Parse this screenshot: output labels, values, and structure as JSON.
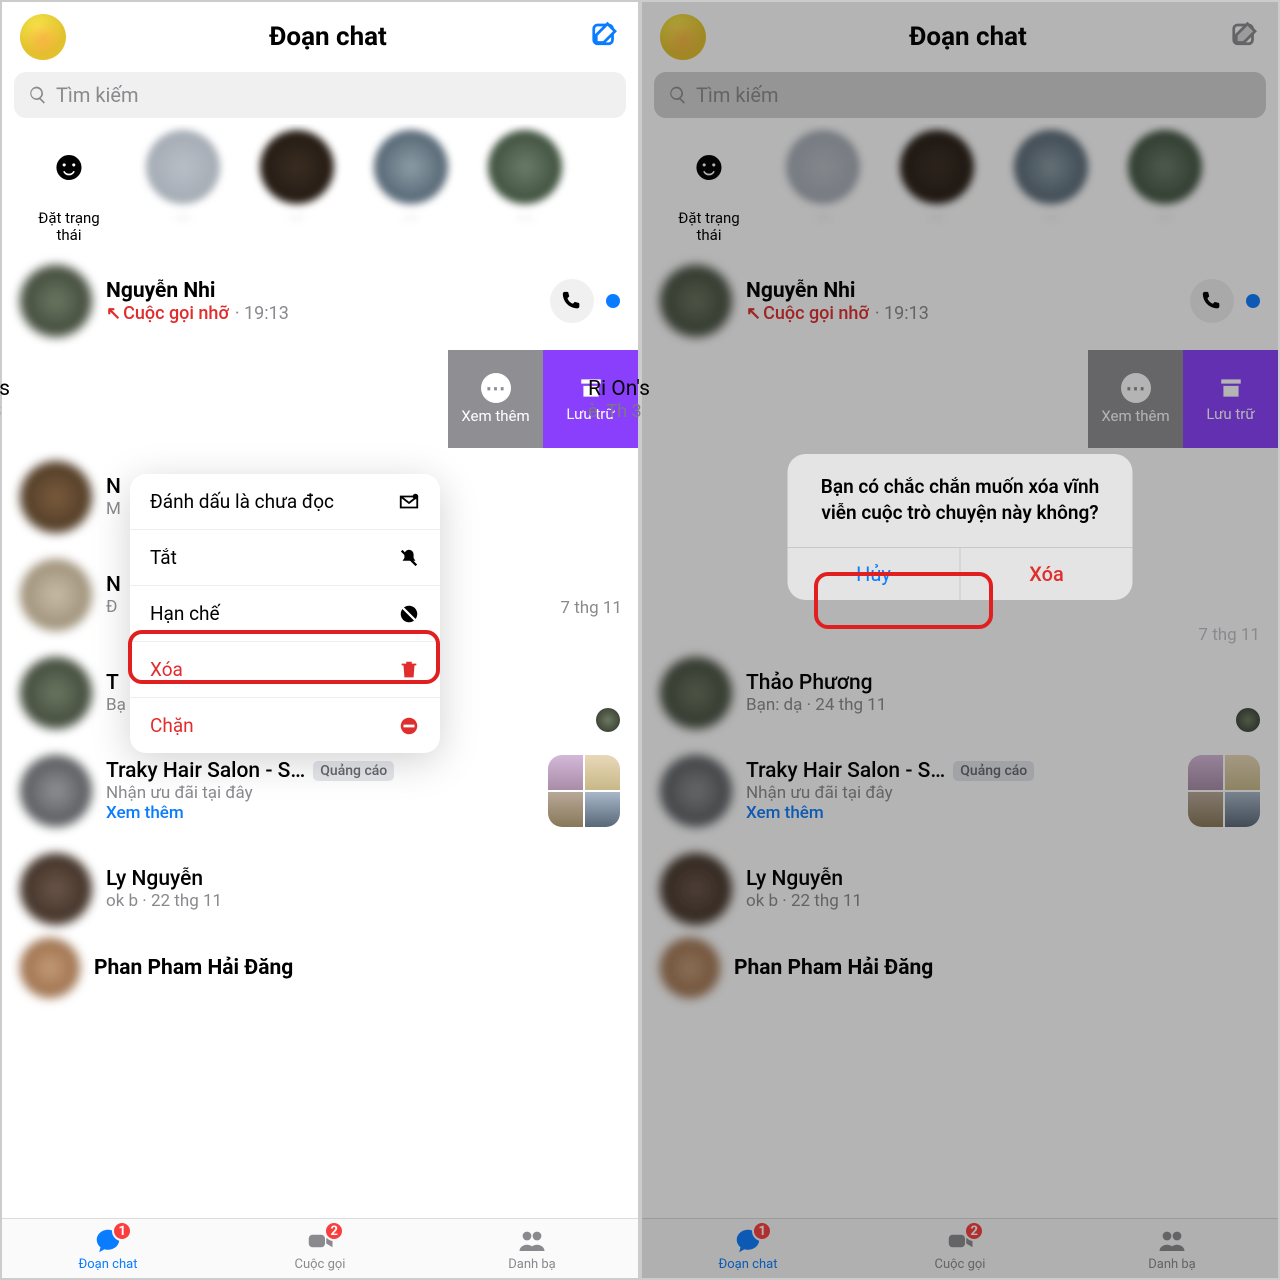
{
  "header": {
    "title": "Đoạn chat"
  },
  "search": {
    "placeholder": "Tìm kiếm"
  },
  "stories": {
    "set_status": "Đặt trạng\nthái"
  },
  "chats": {
    "c1": {
      "name": "Nguyễn Nhi",
      "missed": "Cuộc gọi nhỡ",
      "time": "19:13"
    },
    "c2": {
      "name": "Ri On's",
      "sub": "è.",
      "time": "Th 3"
    },
    "c3": {
      "name_initial": "N",
      "sub_initial": "M"
    },
    "c4": {
      "name_initial": "N",
      "sub_initial": "Đ",
      "date": "7 thg 11"
    },
    "c5": {
      "name_initial": "T",
      "sub_initial": "Bạ",
      "name_full": "Thảo Phương",
      "sub_full": "Bạn: dạ",
      "date": "24 thg 11"
    },
    "c6": {
      "name": "Traky Hair Salon - S…",
      "sub": "Nhận ưu đãi tại đây",
      "ad": "Quảng cáo",
      "more": "Xem thêm"
    },
    "c7": {
      "name": "Ly Nguyễn",
      "sub": "ok b",
      "date": "22 thg 11"
    },
    "c8": {
      "name": "Phan Pham Hải Đăng"
    }
  },
  "swipe": {
    "more": "Xem thêm",
    "archive": "Lưu trữ"
  },
  "menu": {
    "unread": "Đánh dấu là chưa đọc",
    "mute": "Tắt",
    "restrict": "Hạn chế",
    "delete": "Xóa",
    "block": "Chặn"
  },
  "dialog": {
    "msg": "Bạn có chắc chắn muốn xóa vĩnh viễn cuộc trò chuyện này không?",
    "cancel": "Hủy",
    "delete": "Xóa"
  },
  "tabs": {
    "chat": "Đoạn chat",
    "chat_badge": "1",
    "calls": "Cuộc gọi",
    "calls_badge": "2",
    "contacts": "Danh bạ"
  }
}
